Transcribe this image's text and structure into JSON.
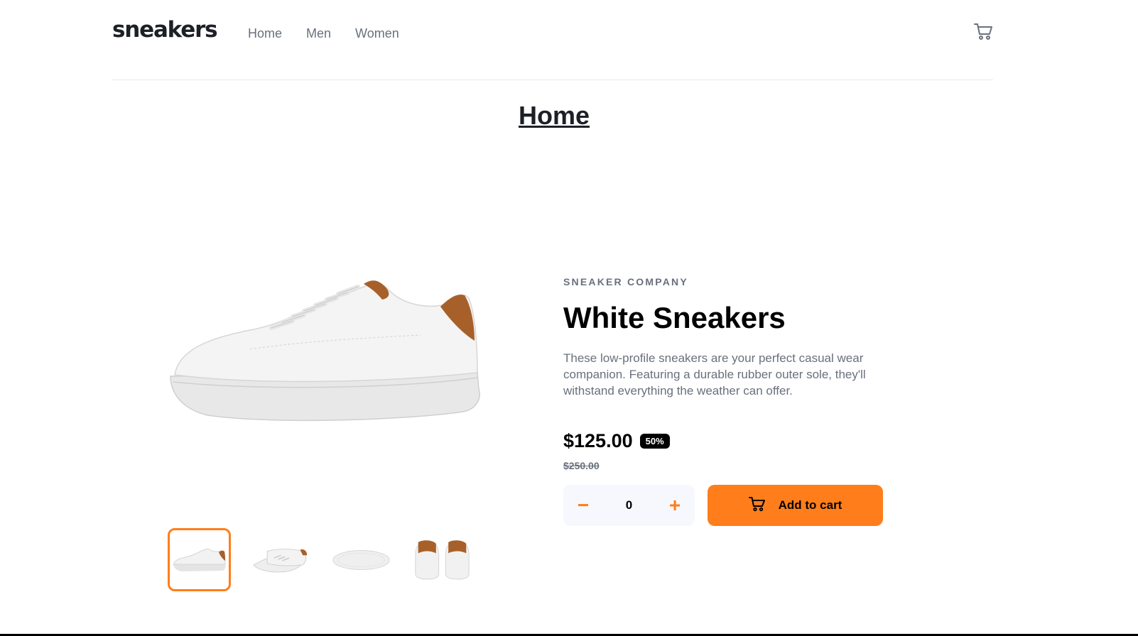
{
  "header": {
    "logo": "sneakers",
    "nav": [
      {
        "label": "Home"
      },
      {
        "label": "Men"
      },
      {
        "label": "Women"
      }
    ],
    "cart_icon": "cart-icon"
  },
  "page": {
    "title": "Home"
  },
  "product": {
    "company": "SNEAKER COMPANY",
    "title": "White Sneakers",
    "description": "These low-profile sneakers are your perfect casual wear companion. Featuring a durable rubber outer sole, they'll withstand everything the weather can offer.",
    "price": "$125.00",
    "discount": "50%",
    "old_price": "$250.00",
    "quantity": "0",
    "minus_label": "−",
    "plus_label": "+",
    "add_to_cart": "Add to cart",
    "thumbnails": [
      {
        "name": "side",
        "active": true
      },
      {
        "name": "top",
        "active": false
      },
      {
        "name": "sole",
        "active": false
      },
      {
        "name": "back",
        "active": false
      }
    ]
  },
  "colors": {
    "accent": "#ff7e1b",
    "text_dark": "#1d2026",
    "text_muted": "#69707d",
    "heel_brown": "#a8602a"
  }
}
